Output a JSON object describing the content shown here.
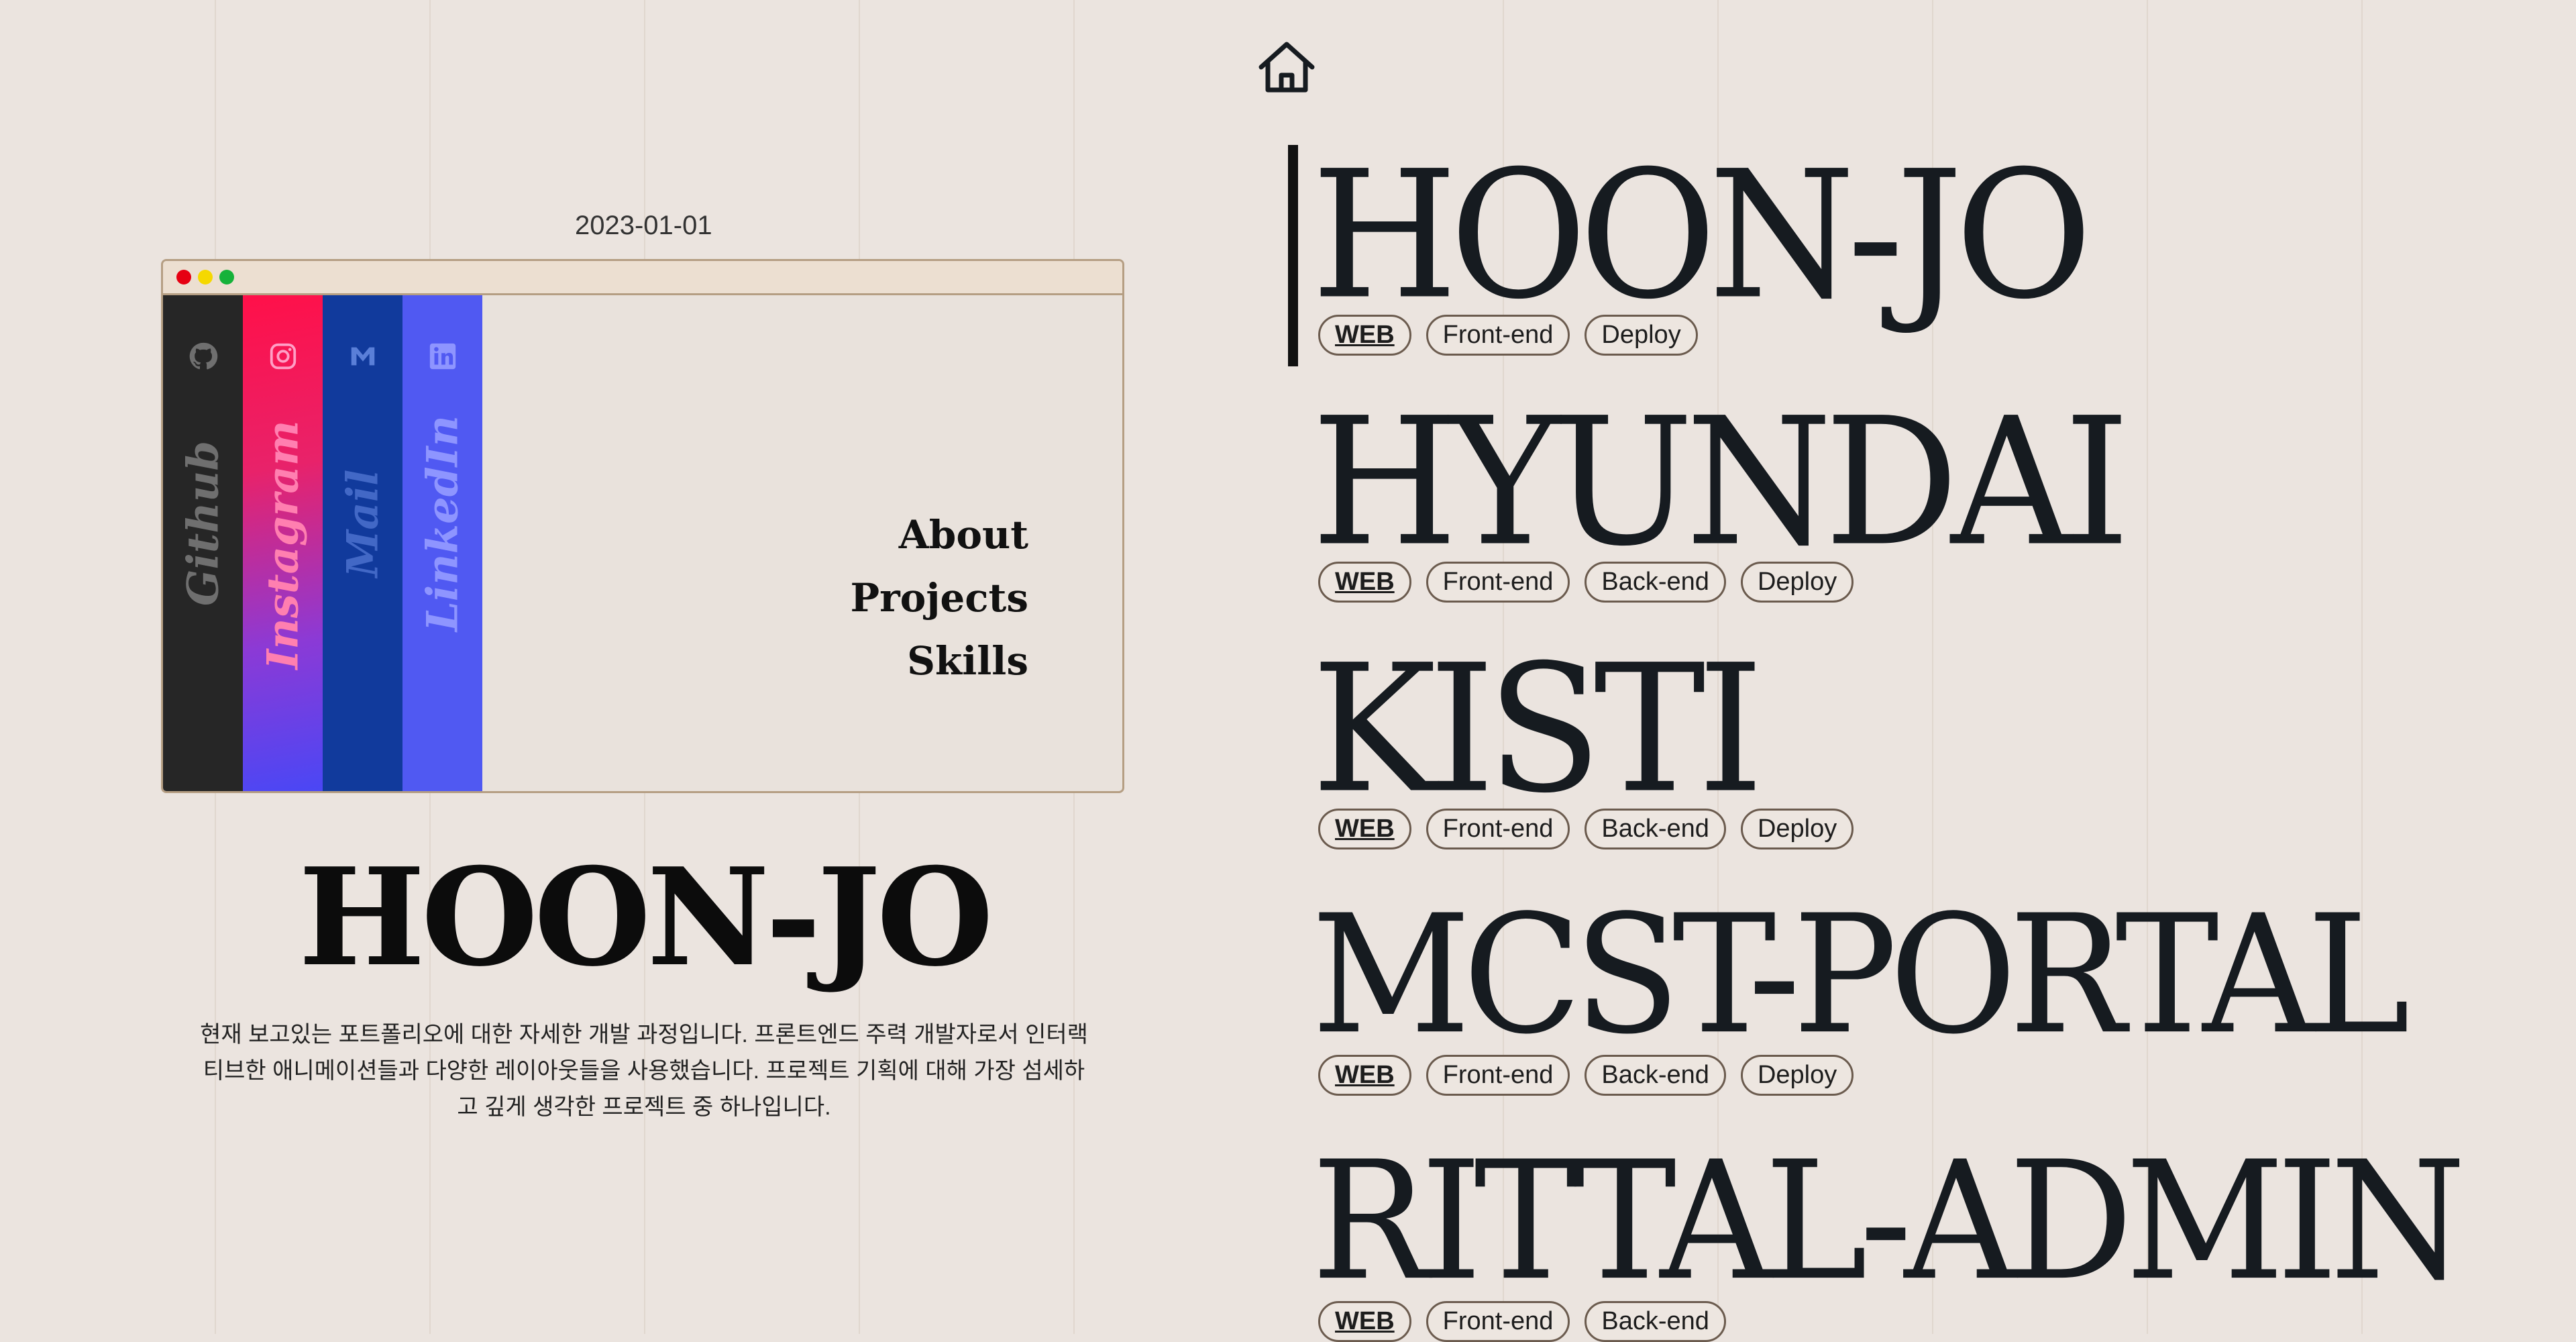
{
  "left": {
    "date": "2023-01-01",
    "social": [
      {
        "label": "Github",
        "icon": "github-icon"
      },
      {
        "label": "Instagram",
        "icon": "instagram-icon"
      },
      {
        "label": "Mail",
        "icon": "mail-icon"
      },
      {
        "label": "LinkedIn",
        "icon": "linkedin-icon"
      }
    ],
    "menu": [
      "About",
      "Projects",
      "Skills"
    ],
    "name": "HOON-JO",
    "description": "현재 보고있는 포트폴리오에 대한 자세한 개발 과정입니다. 프론트엔드 주력 개발자로서 인터랙티브한 애니메이션들과 다양한 레이아웃들을 사용했습니다. 프로젝트 기획에 대해 가장 섬세하고 깊게 생각한 프로젝트 중 하나입니다."
  },
  "right": {
    "home_icon": "home-icon",
    "projects": [
      {
        "title": "HOON-JO",
        "tags": [
          "WEB",
          "Front-end",
          "Deploy"
        ]
      },
      {
        "title": "HYUNDAI",
        "tags": [
          "WEB",
          "Front-end",
          "Back-end",
          "Deploy"
        ]
      },
      {
        "title": "KISTI",
        "tags": [
          "WEB",
          "Front-end",
          "Back-end",
          "Deploy"
        ]
      },
      {
        "title": "MCST-PORTAL",
        "tags": [
          "WEB",
          "Front-end",
          "Back-end",
          "Deploy"
        ]
      },
      {
        "title": "RITTAL-ADMIN",
        "tags": [
          "WEB",
          "Front-end",
          "Back-end"
        ]
      }
    ]
  },
  "colors": {
    "background": "#ebe4df",
    "github": "#262626",
    "instagram": "#ff1049",
    "mail": "#113a9c",
    "linkedin": "#5059f2",
    "title": "#161b20"
  }
}
